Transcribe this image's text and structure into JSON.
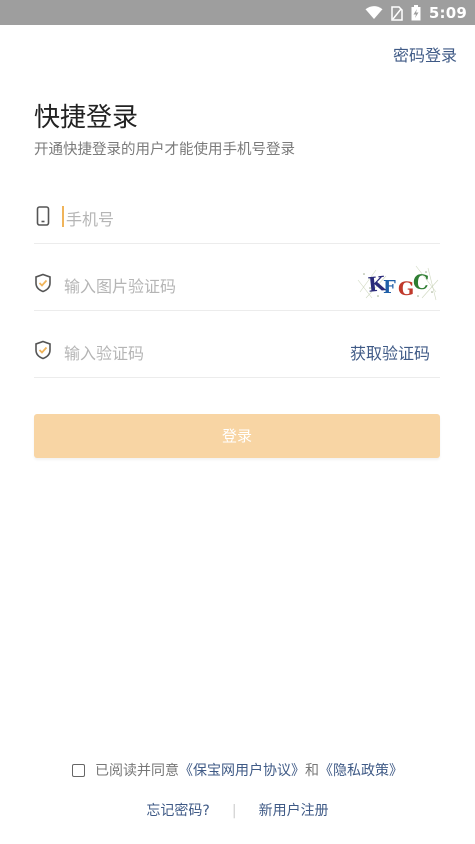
{
  "status_bar": {
    "time": "5:09",
    "icons": [
      "wifi-icon",
      "sim-icon",
      "battery-charging-icon"
    ]
  },
  "header": {
    "password_login_label": "密码登录"
  },
  "main": {
    "title": "快捷登录",
    "subtitle": "开通快捷登录的用户才能使用手机号登录"
  },
  "form": {
    "phone_placeholder": "手机号",
    "image_code_placeholder": "输入图片验证码",
    "captcha_text": "KFGC",
    "sms_code_placeholder": "输入验证码",
    "get_code_label": "获取验证码",
    "login_button_label": "登录"
  },
  "agreement": {
    "prefix": "已阅读并同意",
    "user_agreement": "《保宝网用户协议》",
    "conjunction": "和",
    "privacy_policy": "《隐私政策》"
  },
  "footer": {
    "forgot_password": "忘记密码?",
    "separator": "|",
    "register": "新用户注册"
  },
  "colors": {
    "accent": "#3f5a86",
    "button_disabled": "#f8d5a4",
    "shield_accent": "#f0b45a"
  }
}
